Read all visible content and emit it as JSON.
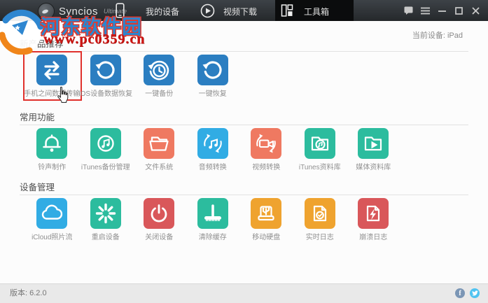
{
  "window": {
    "brand": {
      "name": "Syncios",
      "edition": "Ultimate"
    },
    "nav": [
      {
        "label": "我的设备",
        "icon": "phone-icon"
      },
      {
        "label": "视频下载",
        "icon": "play-icon"
      },
      {
        "label": "工具箱",
        "icon": "grid-icon",
        "active": true
      }
    ],
    "controls": [
      "chat",
      "menu",
      "minimize",
      "maximize",
      "close"
    ],
    "device_status": "当前设备: iPad"
  },
  "sections": [
    {
      "title": "新产品推荐",
      "items": [
        {
          "label": "手机之间数据传输",
          "icon": "transfer-arrows",
          "color": "#2b7ec1",
          "highlighted": true
        },
        {
          "label": "iOS设备数据恢复",
          "icon": "restore-arrow",
          "color": "#2b7ec1"
        },
        {
          "label": "一键备份",
          "icon": "backup-clock",
          "color": "#2b7ec1"
        },
        {
          "label": "一键恢复",
          "icon": "restore-circle",
          "color": "#2b7ec1"
        }
      ]
    },
    {
      "title": "常用功能",
      "items": [
        {
          "label": "铃声制作",
          "icon": "bell",
          "color": "#2cbc9e"
        },
        {
          "label": "iTunes备份管理",
          "icon": "itunes-music",
          "color": "#2cbc9e"
        },
        {
          "label": "文件系统",
          "icon": "folder",
          "color": "#ef7961"
        },
        {
          "label": "音频转换",
          "icon": "audio-convert",
          "color": "#31ace4"
        },
        {
          "label": "视频转换",
          "icon": "video-convert",
          "color": "#ef7961"
        },
        {
          "label": "iTunes资料库",
          "icon": "itunes-library",
          "color": "#2cbc9e"
        },
        {
          "label": "媒体资料库",
          "icon": "media-library",
          "color": "#2cbc9e"
        }
      ]
    },
    {
      "title": "设备管理",
      "items": [
        {
          "label": "iCloud照片流",
          "icon": "icloud-photos",
          "color": "#31ace4"
        },
        {
          "label": "重启设备",
          "icon": "restart",
          "color": "#2cbc9e"
        },
        {
          "label": "关闭设备",
          "icon": "power",
          "color": "#d9575a"
        },
        {
          "label": "清除缓存",
          "icon": "clear-cache",
          "color": "#2cbc9e"
        },
        {
          "label": "移动硬盘",
          "icon": "usb-drive",
          "color": "#efa32f"
        },
        {
          "label": "实时日志",
          "icon": "realtime-log",
          "color": "#efa32f"
        },
        {
          "label": "崩溃日志",
          "icon": "crash-log",
          "color": "#d9575a"
        }
      ]
    }
  ],
  "footer": {
    "version": "版本: 6.2.0",
    "social": [
      "facebook",
      "twitter"
    ]
  },
  "watermark": {
    "site_name": "河东软件园",
    "site_url": "www.pc0359.cn"
  },
  "palette": {
    "highlight": "#e0312c",
    "tab_active_bg": "#0b0c0d",
    "titlebar": "#2e3134"
  }
}
